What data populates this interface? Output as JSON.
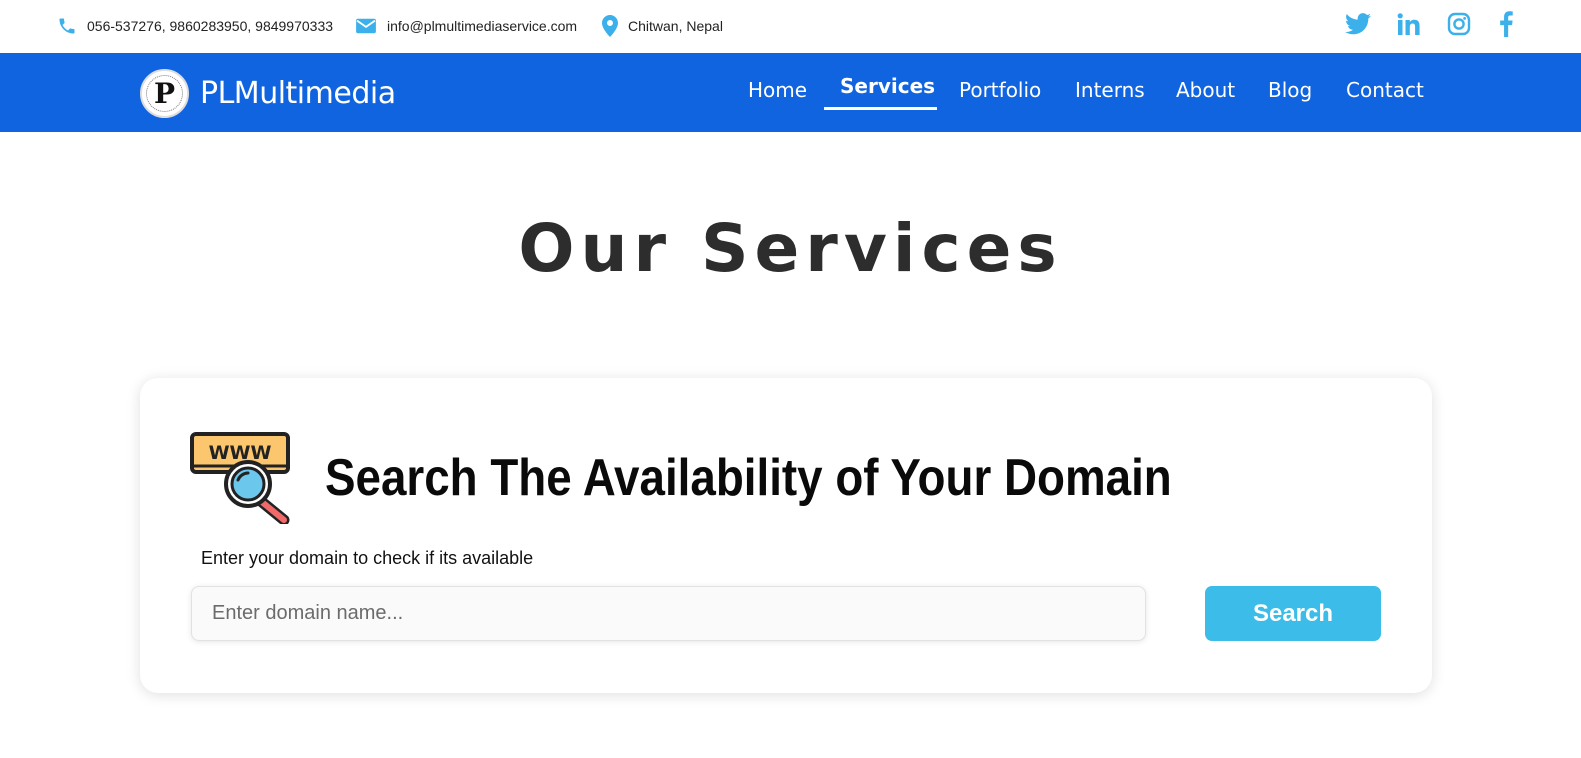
{
  "topbar": {
    "phone": "056-537276, 9860283950, 9849970333",
    "email": "info@plmultimediaservice.com",
    "location": "Chitwan, Nepal",
    "social": [
      "twitter-icon",
      "linkedin-icon",
      "instagram-icon",
      "facebook-icon"
    ],
    "accent_color": "#3cb0ea"
  },
  "navbar": {
    "brand_name": "PLMultimedia",
    "brand_logo_letter": "P",
    "background_color": "#1164e0",
    "items": [
      {
        "label": "Home"
      },
      {
        "label": "Services",
        "active": true
      },
      {
        "label": "Portfolio"
      },
      {
        "label": "Interns"
      },
      {
        "label": "About"
      },
      {
        "label": "Blog"
      },
      {
        "label": "Contact"
      }
    ]
  },
  "main": {
    "title": "Our Services",
    "domain_card": {
      "icon": "www-search-icon",
      "icon_text": "WWW",
      "title": "Search The Availability of Your Domain",
      "label": "Enter your domain to check if its available",
      "input_placeholder": "Enter domain name...",
      "input_value": "",
      "button_label": "Search",
      "button_color": "#3cbde9"
    }
  }
}
